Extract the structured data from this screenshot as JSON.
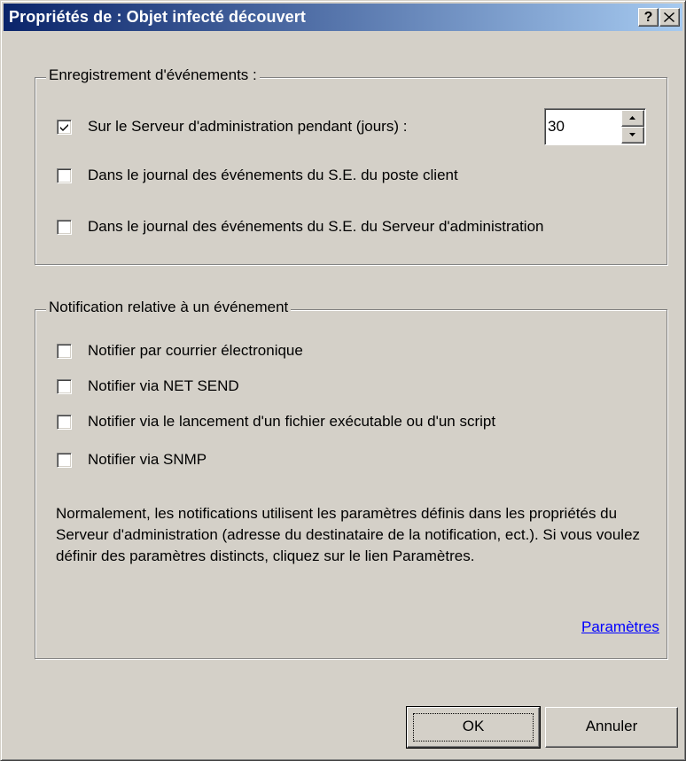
{
  "window": {
    "title": "Propriétés de : Objet infecté découvert",
    "help_label": "?",
    "close_label": "✕"
  },
  "event_log_group": {
    "legend": "Enregistrement d'événements :",
    "items": [
      {
        "label": "Sur le Serveur d'administration pendant (jours) :",
        "checked": true
      },
      {
        "label": "Dans le journal des événements du S.E. du poste client",
        "checked": false
      },
      {
        "label": "Dans le journal des événements du S.E. du Serveur d'administration",
        "checked": false
      }
    ],
    "days_value": "30"
  },
  "notification_group": {
    "legend": "Notification relative à un événement",
    "items": [
      {
        "label": "Notifier par courrier électronique",
        "checked": false
      },
      {
        "label": "Notifier via NET SEND",
        "checked": false
      },
      {
        "label": "Notifier via le lancement d'un fichier exécutable ou d'un script",
        "checked": false
      },
      {
        "label": "Notifier via SNMP",
        "checked": false
      }
    ],
    "note": "Normalement, les notifications utilisent les paramètres définis dans les propriétés du Serveur d'administration (adresse du destinataire de la notification, ect.). Si vous voulez définir des paramètres distincts, cliquez sur le lien Paramètres.",
    "link_label": "Paramètres"
  },
  "buttons": {
    "ok_label": "OK",
    "cancel_label": "Annuler"
  },
  "colors": {
    "face": "#d4d0c8",
    "title_start": "#0a246a",
    "title_end": "#a6caf0",
    "link": "#0000ff"
  }
}
